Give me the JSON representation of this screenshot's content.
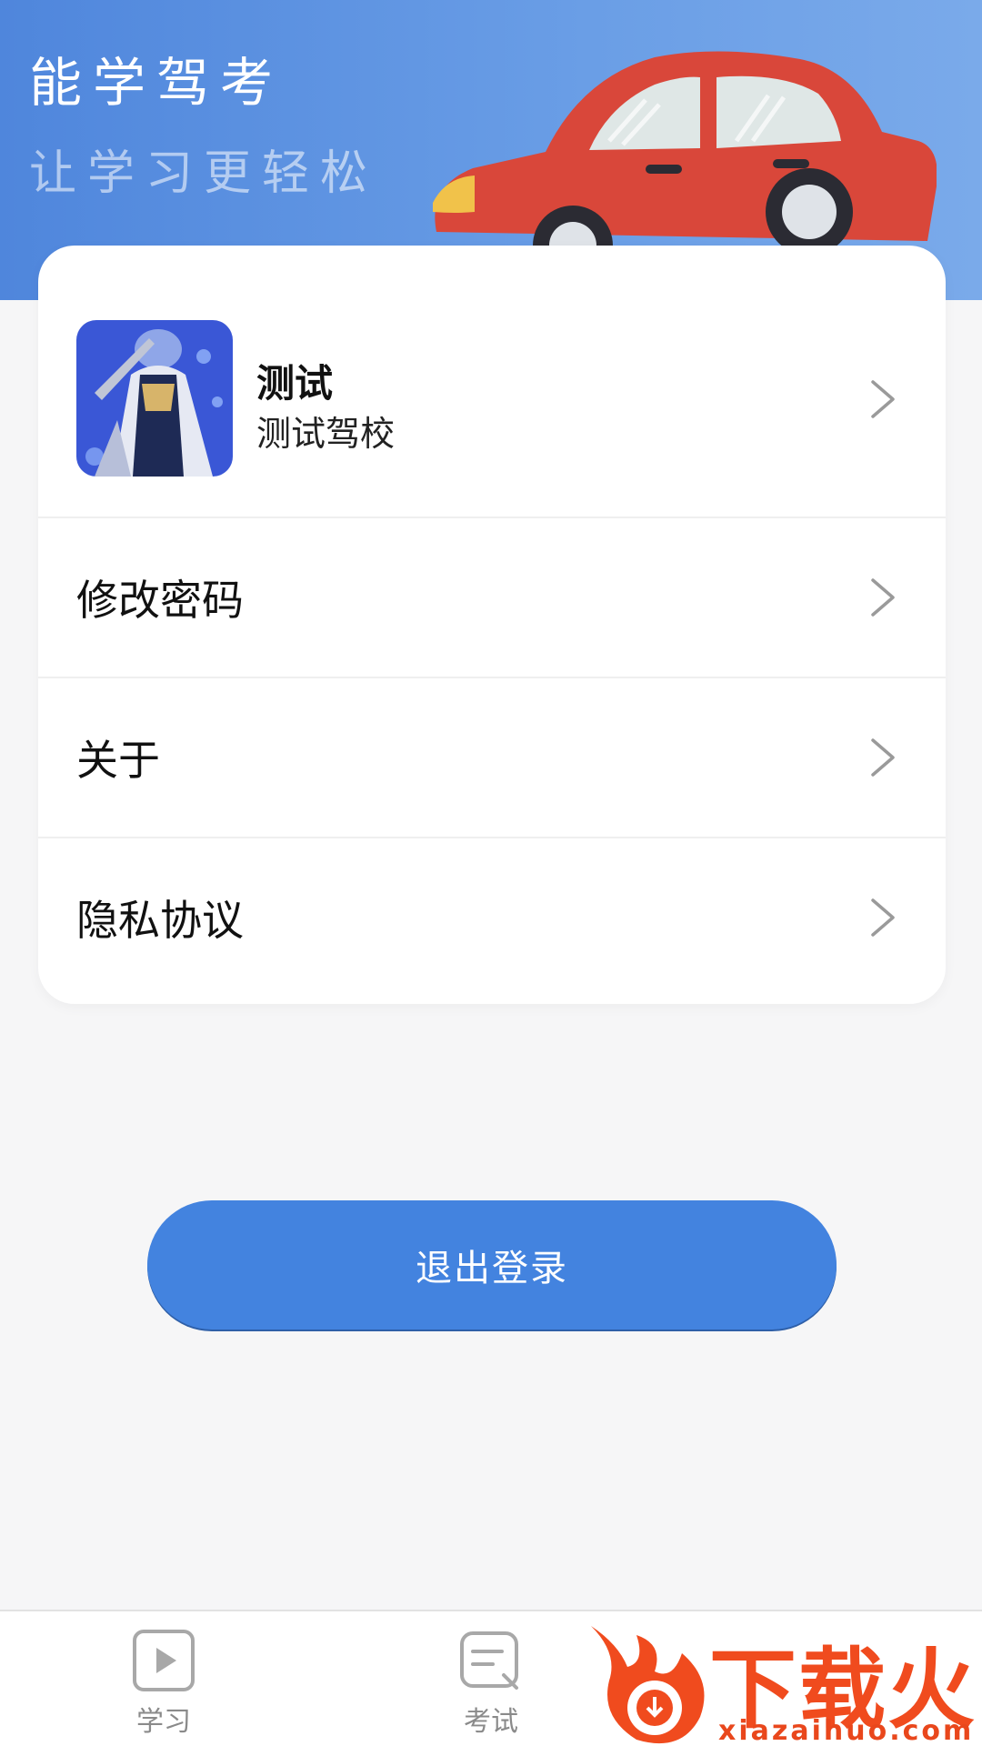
{
  "header": {
    "title": "能学驾考",
    "slogan": "让学习更轻松"
  },
  "profile": {
    "name": "测试",
    "school": "测试驾校"
  },
  "menu": {
    "items": [
      {
        "label": "修改密码"
      },
      {
        "label": "关于"
      },
      {
        "label": "隐私协议"
      }
    ]
  },
  "logout": {
    "label": "退出登录"
  },
  "tabbar": {
    "tabs": [
      {
        "label": "学习",
        "icon": "play-icon"
      },
      {
        "label": "考试",
        "icon": "exam-icon"
      }
    ]
  },
  "watermark": {
    "text": "下载火",
    "url": "xiazaihuo.com"
  },
  "colors": {
    "header": "#5b8fe0",
    "accent": "#4383df",
    "background": "#f6f6f7",
    "car_body": "#d9473a",
    "watermark": "#f04b1e"
  }
}
